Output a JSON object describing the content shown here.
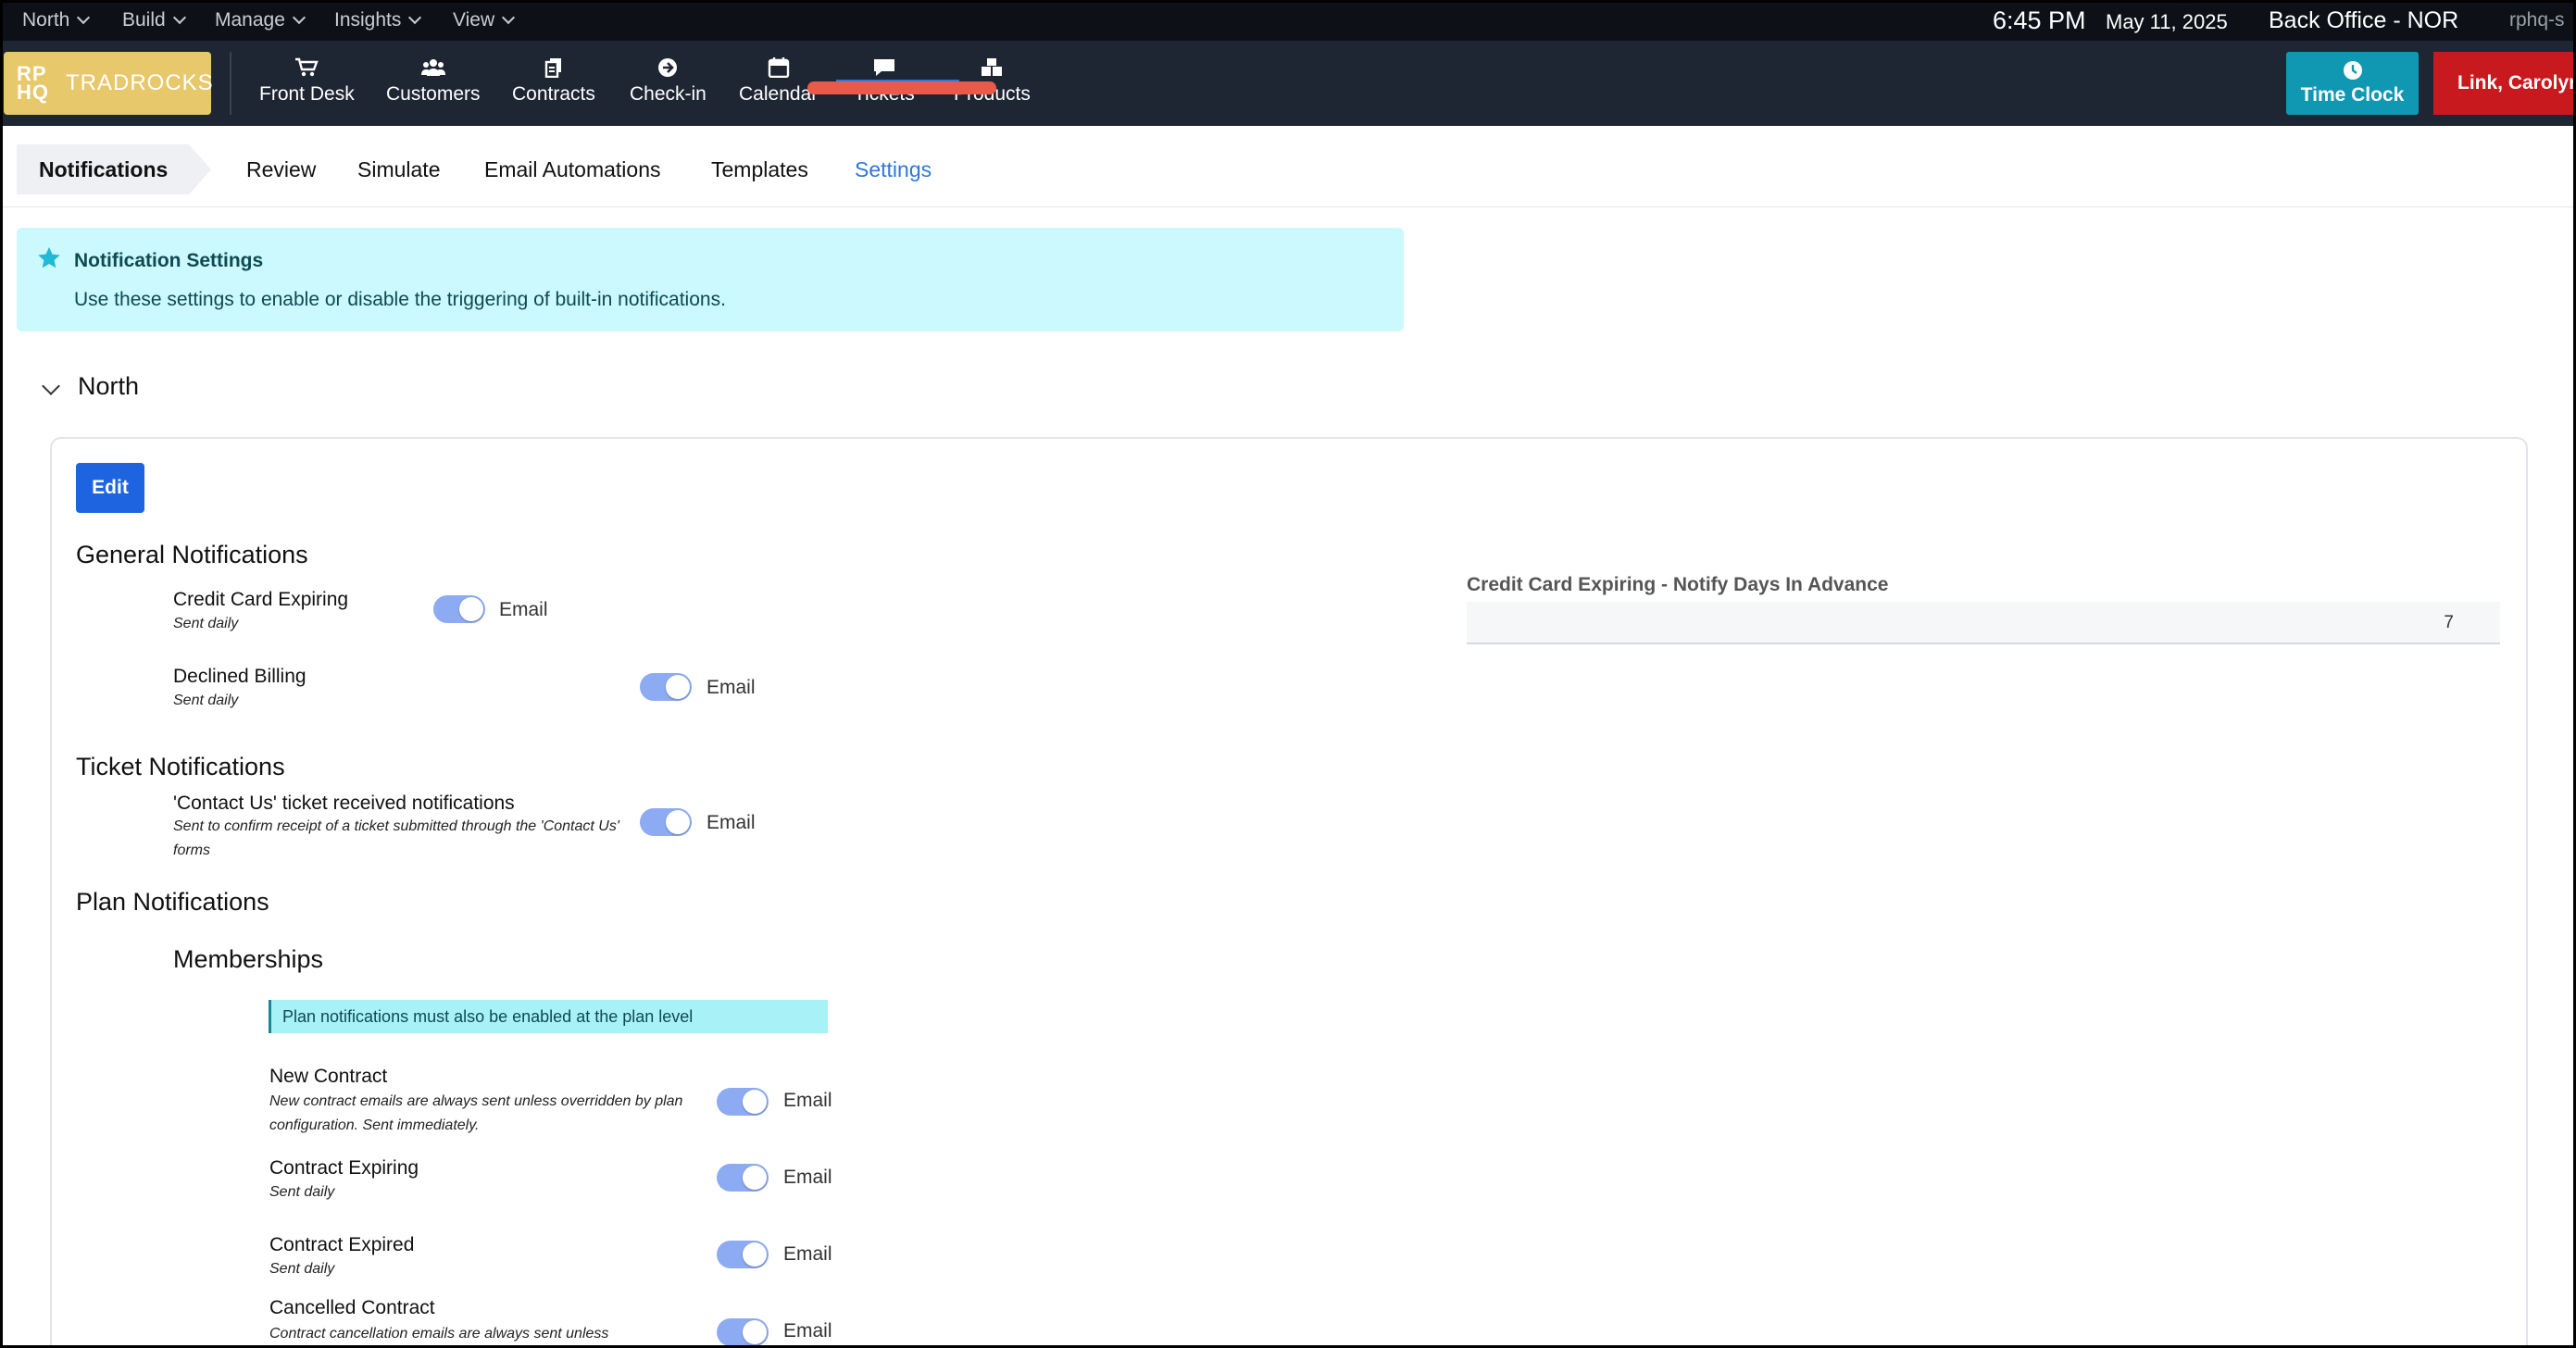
{
  "system_bar": {
    "menus": [
      "North",
      "Build",
      "Manage",
      "Insights",
      "View"
    ],
    "time": "6:45 PM",
    "date": "May 11, 2025",
    "office": "Back Office - NOR",
    "user_host": "rphq-s"
  },
  "navbar": {
    "logo_mark": "RP HQ",
    "logo_text": "TRADROCKS",
    "items": [
      {
        "label": "Front Desk",
        "icon": "cart-icon"
      },
      {
        "label": "Customers",
        "icon": "users-icon"
      },
      {
        "label": "Contracts",
        "icon": "contracts-icon"
      },
      {
        "label": "Check-in",
        "icon": "arrow-circle-icon"
      },
      {
        "label": "Calendar",
        "icon": "calendar-icon"
      },
      {
        "label": "Tickets",
        "icon": "chat-icon"
      },
      {
        "label": "Products",
        "icon": "boxes-icon"
      }
    ],
    "time_clock": "Time Clock",
    "user_button": "Link, Carolyn"
  },
  "subnav": {
    "breadcrumb": "Notifications",
    "tabs": [
      "Review",
      "Simulate",
      "Email Automations",
      "Templates",
      "Settings"
    ],
    "active_tab": "Settings"
  },
  "alert": {
    "title": "Notification Settings",
    "body": "Use these settings to enable or disable the triggering of built-in notifications."
  },
  "section": {
    "title": "North",
    "edit_label": "Edit",
    "general": {
      "title": "General Notifications",
      "items": [
        {
          "title": "Credit Card Expiring",
          "subtitle": "Sent daily",
          "toggle_label": "Email",
          "enabled": true
        },
        {
          "title": "Declined Billing",
          "subtitle": "Sent daily",
          "toggle_label": "Email",
          "enabled": true
        }
      ]
    },
    "ticket": {
      "title": "Ticket Notifications",
      "items": [
        {
          "title": "'Contact Us' ticket received notifications",
          "subtitle": "Sent to confirm receipt of a ticket submitted through the 'Contact Us' forms",
          "toggle_label": "Email",
          "enabled": true
        }
      ]
    },
    "plan": {
      "title": "Plan Notifications",
      "memberships_title": "Memberships",
      "note": "Plan notifications must also be enabled at the plan level",
      "items": [
        {
          "title": "New Contract",
          "subtitle": "New contract emails are always sent unless overridden by plan configuration. Sent immediately.",
          "toggle_label": "Email",
          "enabled": true
        },
        {
          "title": "Contract Expiring",
          "subtitle": "Sent daily",
          "toggle_label": "Email",
          "enabled": true
        },
        {
          "title": "Contract Expired",
          "subtitle": "Sent daily",
          "toggle_label": "Email",
          "enabled": true
        },
        {
          "title": "Cancelled Contract",
          "subtitle": "Contract cancellation emails are always sent unless",
          "toggle_label": "Email",
          "enabled": true
        }
      ]
    },
    "advance_field": {
      "label": "Credit Card Expiring - Notify Days In Advance",
      "value": "7"
    }
  }
}
